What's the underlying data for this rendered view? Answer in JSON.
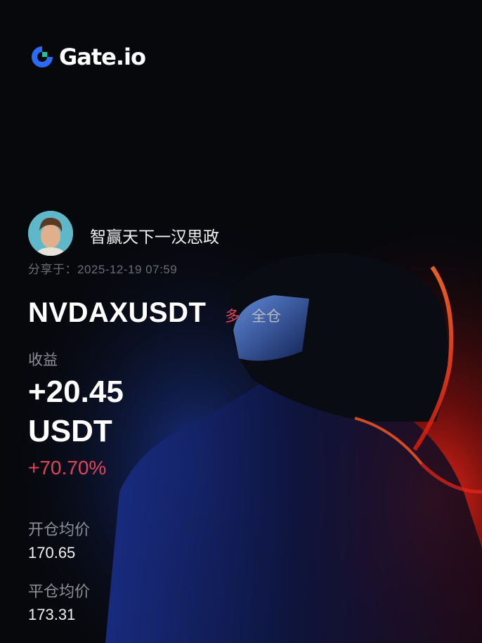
{
  "brand": {
    "name": "Gate.io",
    "accent": "#2a6af5",
    "accent2": "#1ec4a0"
  },
  "user": {
    "name": "智赢天下一汉思政",
    "shared_at": "分享于：2025-12-19 07:59"
  },
  "position": {
    "symbol": "NVDAXUSDT",
    "direction": "多",
    "margin_mode": "全仓",
    "profit_label": "收益",
    "profit_value": "+20.45 USDT",
    "roi": "+70.70%",
    "open_label": "开仓均价",
    "open_price": "170.65",
    "close_label": "平仓均价",
    "close_price": "173.31"
  },
  "colors": {
    "positive": "#e0445c",
    "background": "#07080c"
  }
}
